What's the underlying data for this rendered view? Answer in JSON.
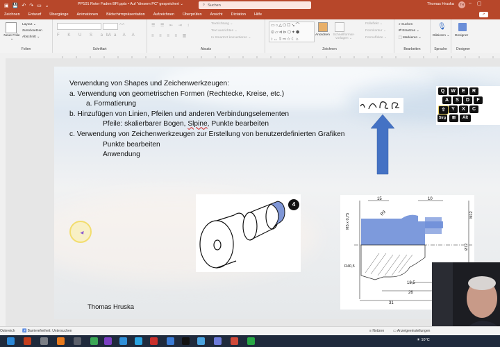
{
  "titlebar": {
    "file_title": "PP101 Roter Faden BFI.pptx • Auf \"diesem PC\" gespeichert ⌄",
    "search_placeholder": "Suchen",
    "user_name": "Thomas Hruska",
    "user_initials": "TH"
  },
  "menu": {
    "tabs": [
      "Zeichnen",
      "Entwurf",
      "Übergänge",
      "Animationen",
      "Bildschirmpräsentation",
      "Aufzeichnen",
      "Überprüfen",
      "Ansicht",
      "Dictation",
      "Hilfe"
    ],
    "right_button": "↗"
  },
  "ribbon": {
    "groups": {
      "folien": "Folien",
      "schriftart": "Schriftart",
      "absatz": "Absatz",
      "zeichnen": "Zeichnen",
      "bearbeiten": "Bearbeiten",
      "sprache": "Sprache",
      "designer": "Designer"
    },
    "buttons": {
      "neue_folie": "Neue Folie ⌄",
      "layout": "Layout ⌄",
      "zuruecksetzen": "Zurücksetzen",
      "abschnitt": "Abschnitt ⌄",
      "textrichtung": "Textrichtung ⌄",
      "text_ausrichten": "Text ausrichten ⌄",
      "smartart": "In SmartArt konvertieren ⌄",
      "anordnen": "Anordnen",
      "schnellformatvorlagen": "Schnellformat-vorlagen ⌄",
      "fuelleffekt": "Fülleffekt ⌄",
      "formkontur": "Formkontur ⌄",
      "formeffekte": "Formeffekte ⌄",
      "suchen": "Suchen",
      "ersetzen": "Ersetzen ⌄",
      "markieren": "Markieren ⌄",
      "diktieren": "Diktieren ⌄",
      "designer": "Designer"
    }
  },
  "slide": {
    "outline": [
      "Verwendung von Shapes und Zeichenwerkzeugen:",
      "a.   Verwendung von geometrischen Formen (Rechtecke, Kreise, etc.)",
      "a.   Formatierung",
      "b. Hinzufügen von Linien, Pfeilen und anderen Verbindungselementen",
      "Pfeile: skalierbarer Bogen, ",
      "Slpine",
      ", Punkte bearbeiten",
      "c. Verwendung von Zeichenwerkzeugen zur Erstellung von benutzerdefinierten Grafiken",
      "Punkte bearbeiten",
      "Anwendung"
    ],
    "author": "Thomas Hruska",
    "part_badge": "4",
    "drawing_dims": [
      "15",
      "10",
      "M5 x 0,75",
      "R9",
      "M12",
      "Ø12",
      "R40,5",
      "18,5",
      "26",
      "31"
    ],
    "keyboard_keys": [
      "Q",
      "W",
      "E",
      "R",
      "A",
      "S",
      "D",
      "F",
      "Y",
      "X",
      "C",
      "Strg",
      "Alt"
    ]
  },
  "status": {
    "left": "Ostereich",
    "accessibility": "Barrierefreiheit: Untersuchen",
    "notes": "Notizen",
    "display": "Anzeigeeinstellungen"
  },
  "taskbar": {
    "weather": "10°C"
  }
}
